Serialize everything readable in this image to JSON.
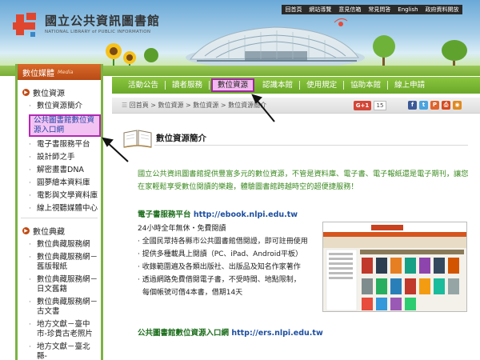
{
  "header": {
    "logo_zh": "國立公共資訊圖書館",
    "logo_en": "NATIONAL LIBRARY of PUBLIC INFORMATION",
    "top_links": [
      "回首頁",
      "網站導覽",
      "意見信箱",
      "常見問答",
      "English",
      "政府資料開放"
    ]
  },
  "sidebar": {
    "title": "數位媒體",
    "title_en": "Media",
    "sections": [
      {
        "title": "數位資源",
        "items": [
          "數位資源簡介",
          "公共圖書館數位資源入口網",
          "電子書服務平台",
          "設計師之手",
          "解密畫書DNA",
          "圓夢繪本資料庫",
          "電影與文學資料庫",
          "線上視聽媒體中心"
        ]
      },
      {
        "title": "數位典藏",
        "items": [
          "數位典藏服務網",
          "數位典藏服務網－舊版報紙",
          "數位典藏服務網－日文舊籍",
          "數位典藏服務網－古文書",
          "地方文獻－臺中市-珍貴古老照片",
          "地方文獻－臺北縣-"
        ]
      }
    ]
  },
  "nav": {
    "items": [
      "活動公告",
      "讀者服務",
      "數位資源",
      "認識本館",
      "使用規定",
      "協助本館",
      "線上申請"
    ],
    "active_index": 2
  },
  "breadcrumb": "回首頁 > 數位資源 > 數位資源 > 數位資源簡介",
  "social": {
    "gplus": "G+1",
    "gplus_count": "15"
  },
  "content": {
    "title": "數位資源簡介",
    "intro": "國立公共資訊圖書館提供豐富多元的數位資源，不管是資料庫、電子書、電子報紙還是電子期刊，讓您在家輕鬆享受數位閱讀的樂趣，體驗圖書館跨越時空的超便捷服務！",
    "section1": {
      "title": "電子書服務平台",
      "url": "http://ebook.nlpi.edu.tw",
      "lines": [
        "24小時全年無休・免費閱讀",
        "· 全國民眾持各縣市公共圖書館借閱證，即可註冊使用",
        "· 提供多種載具上閱讀（PC、iPad、Android平板）",
        "· 收錄範圍遍及各類出版社、出版品及知名作家著作",
        "· 透過網路免費借閱電子書，不受時間、地點限制，",
        "每個帳號可借4本書，借期14天"
      ]
    },
    "section2": {
      "title": "公共圖書館數位資源入口網",
      "url": "http://ers.nlpi.edu.tw"
    }
  },
  "colors": {
    "accent_green": "#7cb344",
    "sidebar_head": "#c9561c",
    "highlight_fill": "#f2c3f2",
    "highlight_border": "#b428b4"
  }
}
